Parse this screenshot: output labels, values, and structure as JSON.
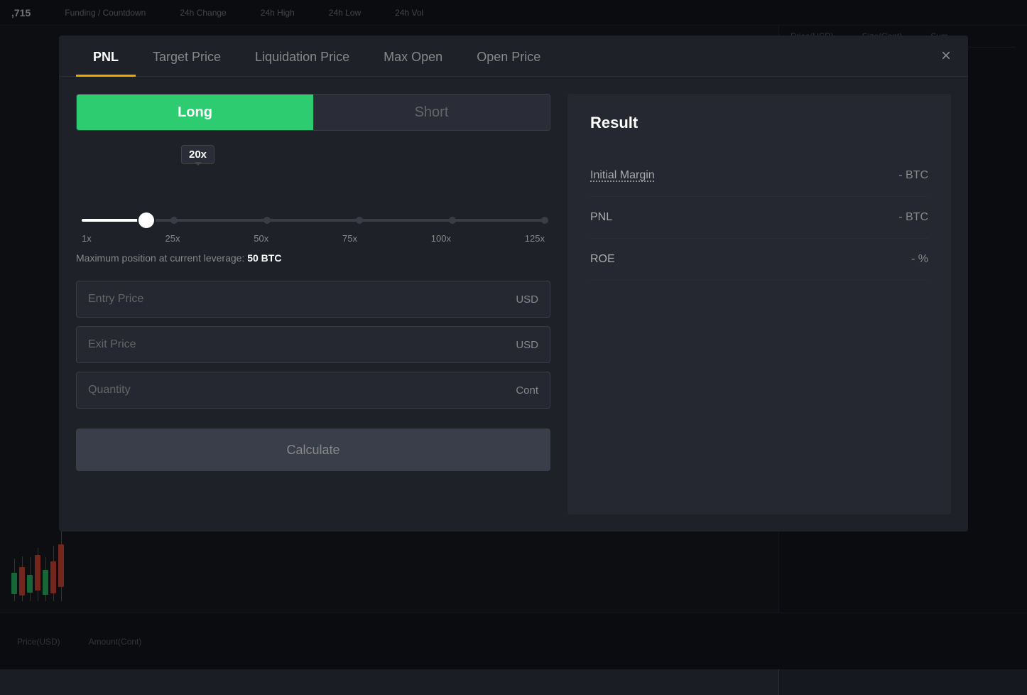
{
  "topbar": {
    "ticker": ",715",
    "columns": [
      "Funding / Countdown",
      "24h Change",
      "24h High",
      "24h Low",
      "24h Vol"
    ]
  },
  "rightColumns": {
    "headers": [
      "Price(USD)",
      "Size(Cont)",
      "Sum"
    ]
  },
  "modal": {
    "tabs": [
      {
        "id": "pnl",
        "label": "PNL",
        "active": true
      },
      {
        "id": "target-price",
        "label": "Target Price",
        "active": false
      },
      {
        "id": "liquidation-price",
        "label": "Liquidation Price",
        "active": false
      },
      {
        "id": "max-open",
        "label": "Max Open",
        "active": false
      },
      {
        "id": "open-price",
        "label": "Open Price",
        "active": false
      }
    ],
    "close_label": "×"
  },
  "calculator": {
    "long_label": "Long",
    "short_label": "Short",
    "leverage_tooltip": "20x",
    "leverage_marks": [
      "1x",
      "25x",
      "50x",
      "75x",
      "100x",
      "125x"
    ],
    "max_position_prefix": "Maximum position at current leverage:",
    "max_position_value": "50 BTC",
    "entry_price_placeholder": "Entry Price",
    "entry_price_unit": "USD",
    "exit_price_placeholder": "Exit Price",
    "exit_price_unit": "USD",
    "quantity_placeholder": "Quantity",
    "quantity_unit": "Cont",
    "calculate_label": "Calculate"
  },
  "result": {
    "title": "Result",
    "rows": [
      {
        "label": "Initial Margin",
        "value": "- BTC",
        "dotted": true
      },
      {
        "label": "PNL",
        "value": "- BTC",
        "dotted": false
      },
      {
        "label": "ROE",
        "value": "- %",
        "dotted": false
      }
    ]
  },
  "bottomBar": {
    "col1": "Price(USD)",
    "col2": "Amount(Cont)"
  },
  "colors": {
    "accent": "#f0a500",
    "long": "#2ecc71",
    "short_bg": "#2a2d38"
  }
}
